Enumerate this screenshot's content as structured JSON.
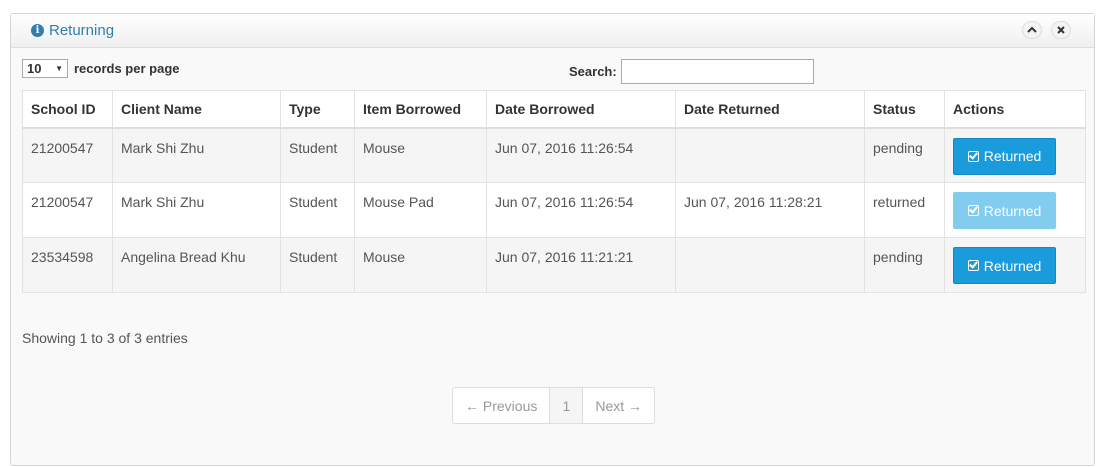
{
  "panel": {
    "title": "Returning",
    "title_icon": "info-circle-icon"
  },
  "controls": {
    "length_value": "10",
    "length_label": "records per page",
    "search_label": "Search:",
    "search_value": "",
    "search_placeholder": ""
  },
  "table": {
    "columns": [
      "School ID",
      "Client Name",
      "Type",
      "Item Borrowed",
      "Date Borrowed",
      "Date Returned",
      "Status",
      "Actions"
    ],
    "rows": [
      {
        "school_id": "21200547",
        "client_name": "Mark Shi Zhu",
        "type": "Student",
        "item": "Mouse",
        "date_borrowed": "Jun 07, 2016 11:26:54",
        "date_returned": "",
        "status": "pending",
        "action": "Returned",
        "action_enabled": true
      },
      {
        "school_id": "21200547",
        "client_name": "Mark Shi Zhu",
        "type": "Student",
        "item": "Mouse Pad",
        "date_borrowed": "Jun 07, 2016 11:26:54",
        "date_returned": "Jun 07, 2016 11:28:21",
        "status": "returned",
        "action": "Returned",
        "action_enabled": false
      },
      {
        "school_id": "23534598",
        "client_name": "Angelina Bread Khu",
        "type": "Student",
        "item": "Mouse",
        "date_borrowed": "Jun 07, 2016 11:21:21",
        "date_returned": "",
        "status": "pending",
        "action": "Returned",
        "action_enabled": true
      }
    ]
  },
  "footer": {
    "info": "Showing 1 to 3 of 3 entries",
    "prev": "← Previous",
    "page": "1",
    "next": "Next →"
  },
  "colors": {
    "accent": "#317eac",
    "button": "#1a9bdc",
    "button_disabled": "#7ccaf0"
  }
}
